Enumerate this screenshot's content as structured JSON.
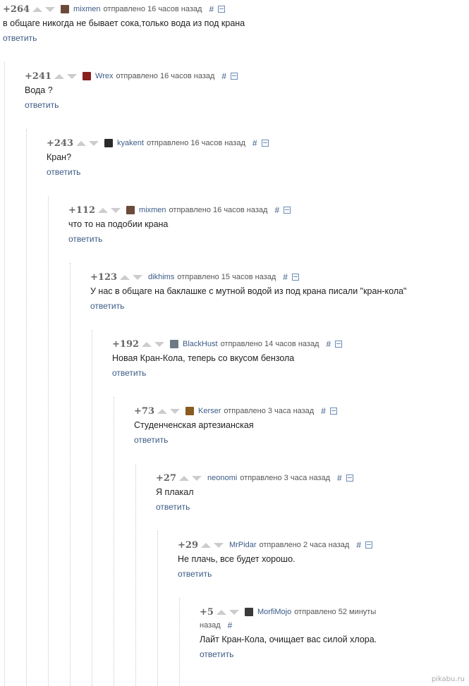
{
  "comments": [
    {
      "score": "+264",
      "author": "mixmen",
      "avatar_color": "#6b4a3a",
      "sent": "отправлено 16 часов назад",
      "permalink": "#",
      "text": "в общаге никогда не бывает сока,только вода из под крана",
      "reply": "ответить"
    },
    {
      "score": "+241",
      "author": "Wrex",
      "avatar_color": "#8a1f1f",
      "sent": "отправлено 16 часов назад",
      "permalink": "#",
      "text": "Вода ?",
      "reply": "ответить"
    },
    {
      "score": "+243",
      "author": "kyakent",
      "avatar_color": "#2b2b2b",
      "sent": "отправлено 16 часов назад",
      "permalink": "#",
      "text": "Кран?",
      "reply": "ответить"
    },
    {
      "score": "+112",
      "author": "mixmen",
      "avatar_color": "#6b4a3a",
      "sent": "отправлено 16 часов назад",
      "permalink": "#",
      "text": "что то на подобии крана",
      "reply": "ответить"
    },
    {
      "score": "+123",
      "author": "dikhims",
      "avatar_color": "",
      "sent": "отправлено 15 часов назад",
      "permalink": "#",
      "text": "У нас в общаге на баклашке с мутной водой из под крана писали \"кран-кола\"",
      "reply": "ответить"
    },
    {
      "score": "+192",
      "author": "BlackHust",
      "avatar_color": "#6d7a86",
      "sent": "отправлено 14 часов назад",
      "permalink": "#",
      "text": "Новая Кран-Кола, теперь со вкусом бензола",
      "reply": "ответить"
    },
    {
      "score": "+73",
      "author": "Kerser",
      "avatar_color": "#8a5a20",
      "sent": "отправлено 3 часа назад",
      "permalink": "#",
      "text": "Студенченская артезианская",
      "reply": "ответить"
    },
    {
      "score": "+27",
      "author": "neonomi",
      "avatar_color": "",
      "sent": "отправлено 3 часа назад",
      "permalink": "#",
      "text": "Я плакал",
      "reply": "ответить"
    },
    {
      "score": "+29",
      "author": "MrPidar",
      "avatar_color": "",
      "sent": "отправлено 2 часа назад",
      "permalink": "#",
      "text": "Не плачь, все будет хорошо.",
      "reply": "ответить"
    },
    {
      "score": "+5",
      "author": "MorfiMojo",
      "avatar_color": "#3a3a3a",
      "sent": "отправлено 52 минуты",
      "sent_cont": "назад",
      "permalink": "#",
      "text": "Лайт Кран-Кола, очищает вас силой хлора.",
      "reply": "ответить"
    }
  ],
  "watermark": "pikabu.ru"
}
